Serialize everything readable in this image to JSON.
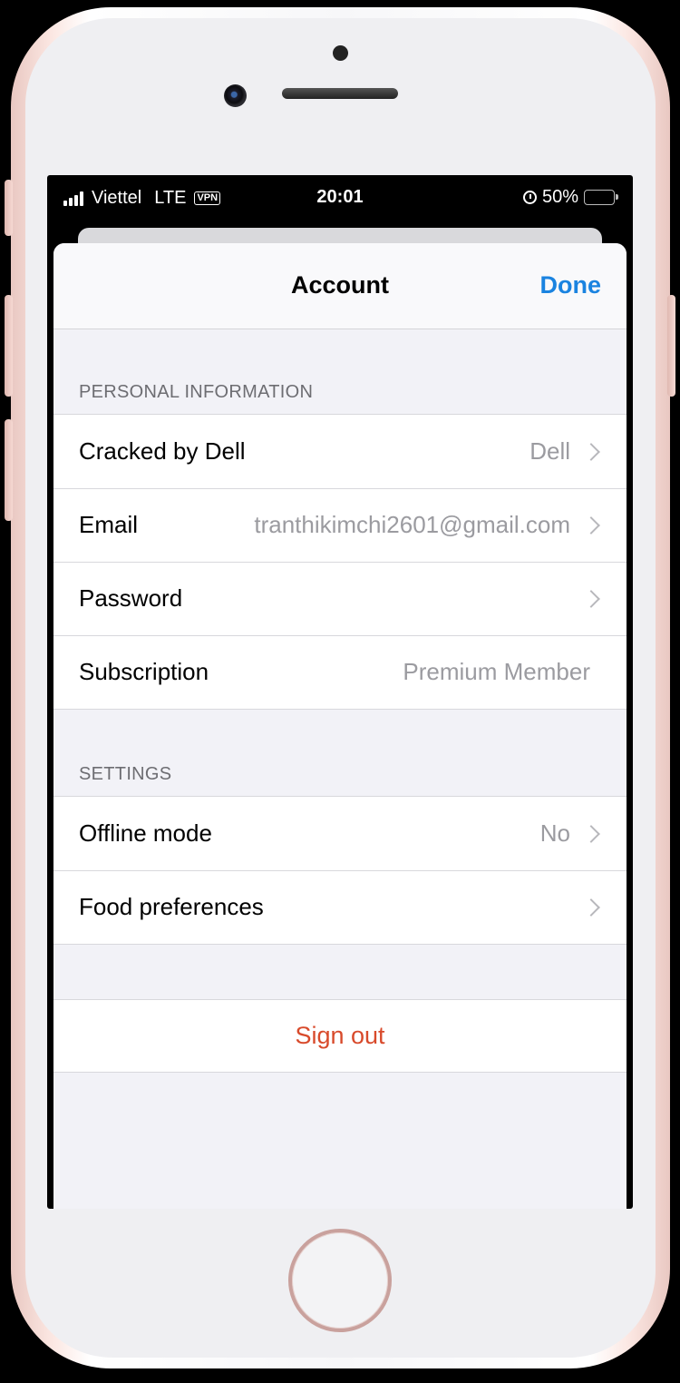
{
  "status_bar": {
    "carrier": "Viettel",
    "network": "LTE",
    "vpn": "VPN",
    "time": "20:01",
    "battery": "50%",
    "battery_level": 0.5,
    "icons": [
      "signal-icon",
      "vpn-icon",
      "alarm-icon",
      "battery-icon"
    ]
  },
  "nav": {
    "title": "Account",
    "done": "Done"
  },
  "sections": {
    "personal": {
      "header": "PERSONAL INFORMATION",
      "rows": [
        {
          "label": "Cracked by Dell",
          "value": "Dell"
        },
        {
          "label": "Email",
          "value": "tranthikimchi2601@gmail.com"
        },
        {
          "label": "Password",
          "value": ""
        },
        {
          "label": "Subscription",
          "value": "Premium Member"
        }
      ]
    },
    "settings": {
      "header": "SETTINGS",
      "rows": [
        {
          "label": "Offline mode",
          "value": "No"
        },
        {
          "label": "Food preferences",
          "value": ""
        }
      ]
    }
  },
  "sign_out": "Sign out",
  "colors": {
    "accent": "#1a83e0",
    "destructive": "#d84a2b",
    "secondary_text": "#9b9ba0",
    "section_header": "#6d6d72",
    "grouped_background": "#f2f2f7"
  }
}
